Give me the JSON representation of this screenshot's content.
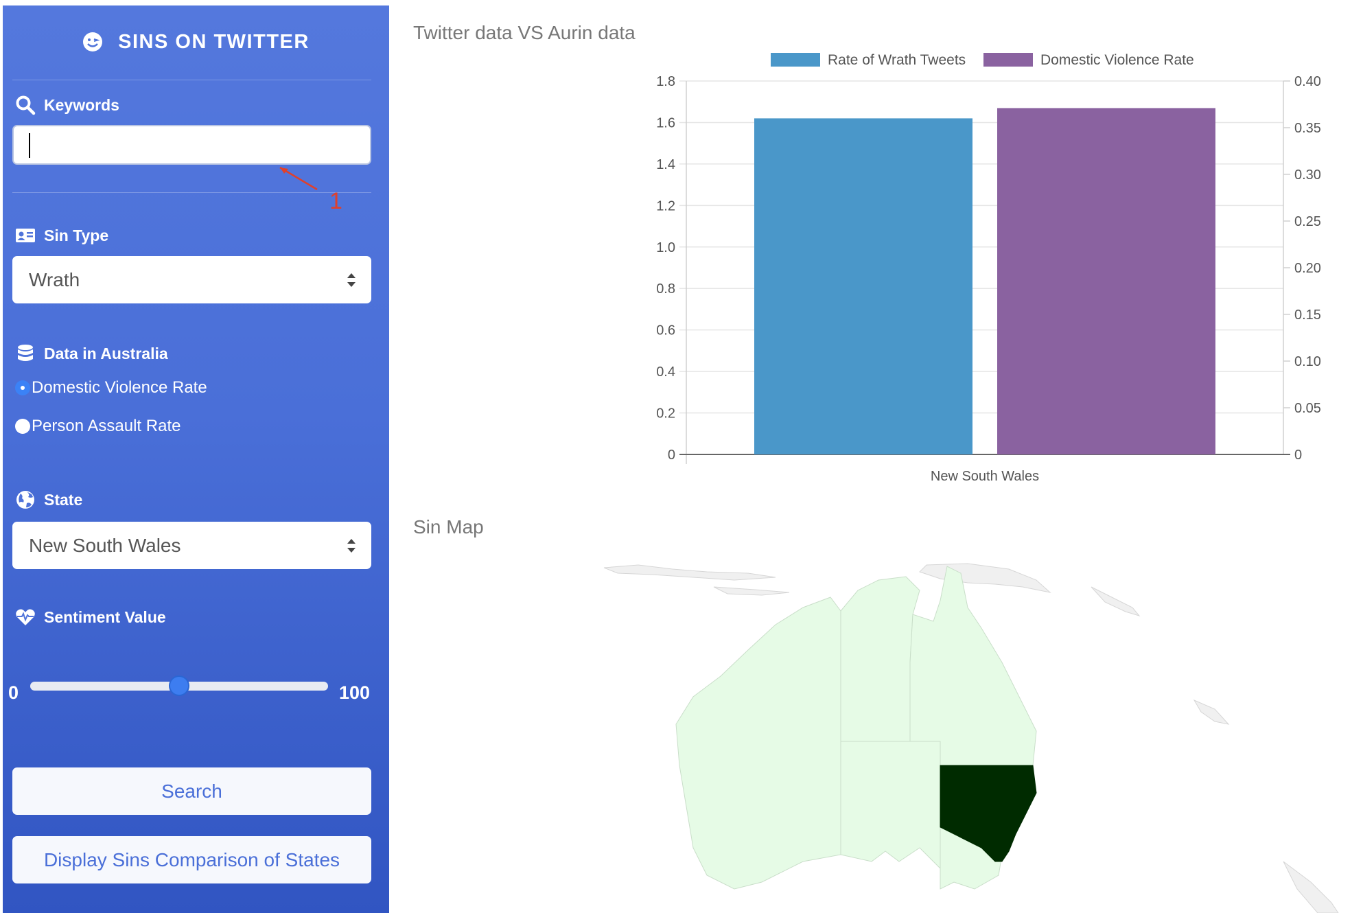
{
  "sidebar": {
    "brand": "SINS ON TWITTER",
    "keywords": {
      "label": "Keywords",
      "value": "",
      "annotation": "1"
    },
    "sin_type": {
      "label": "Sin Type",
      "selected": "Wrath"
    },
    "data_source": {
      "label": "Data in Australia",
      "options": [
        "Domestic Violence Rate",
        "Person Assault Rate"
      ],
      "selected_index": 0
    },
    "state": {
      "label": "State",
      "selected": "New South Wales"
    },
    "sentiment": {
      "label": "Sentiment Value",
      "min": "0",
      "max": "100",
      "value": 50
    },
    "search_label": "Search",
    "compare_label": "Display Sins Comparison of States"
  },
  "main": {
    "chart_title": "Twitter data VS Aurin data",
    "map_title": "Sin Map"
  },
  "colors": {
    "series1": "#4a97c9",
    "series2": "#8a62a0",
    "map_land": "#e6fbe6",
    "map_highlight": "#002b00",
    "map_other": "#f0f0f0"
  },
  "chart_data": {
    "type": "bar",
    "categories": [
      "New South Wales"
    ],
    "series": [
      {
        "name": "Rate of Wrath Tweets",
        "values": [
          1.62
        ],
        "axis": "left"
      },
      {
        "name": "Domestic Violence Rate",
        "values": [
          0.371
        ],
        "axis": "right"
      }
    ],
    "y_left": {
      "ticks": [
        "0",
        "0.2",
        "0.4",
        "0.6",
        "0.8",
        "1.0",
        "1.2",
        "1.4",
        "1.6",
        "1.8"
      ],
      "range": [
        0,
        1.8
      ]
    },
    "y_right": {
      "ticks": [
        "0",
        "0.05",
        "0.10",
        "0.15",
        "0.20",
        "0.25",
        "0.30",
        "0.35",
        "0.40"
      ],
      "range": [
        0,
        0.4
      ]
    },
    "legend": "top",
    "grid": true
  }
}
